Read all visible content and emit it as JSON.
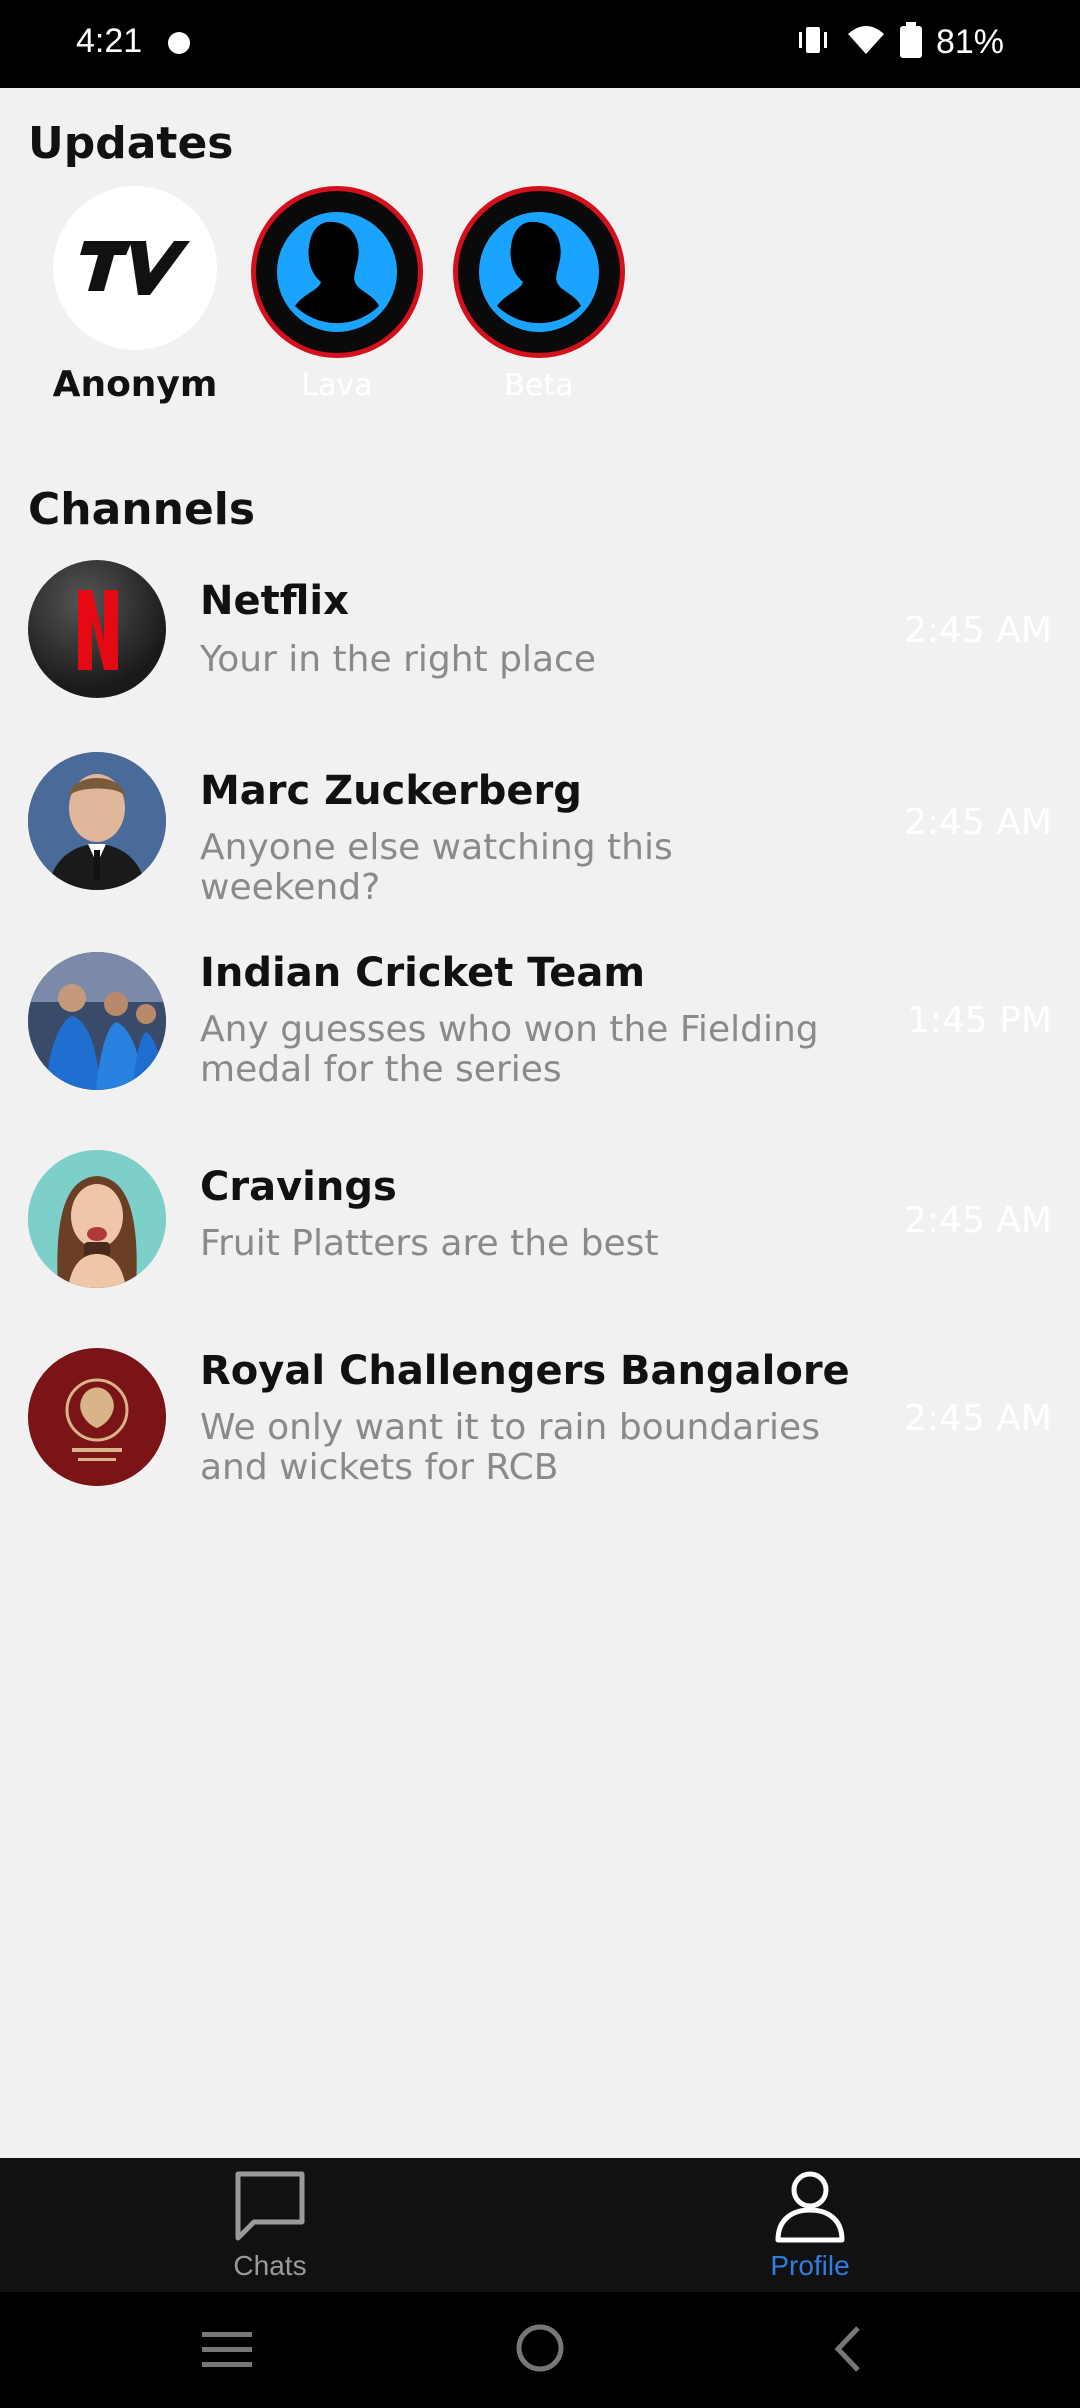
{
  "status_bar": {
    "time": "4:21",
    "battery": "81%"
  },
  "updates": {
    "title": "Updates",
    "stories": [
      {
        "label": "Anonym",
        "icon": "tv-logo-icon"
      },
      {
        "label": "Lava",
        "icon": "person-silhouette-icon"
      },
      {
        "label": "Beta",
        "icon": "person-silhouette-icon"
      }
    ]
  },
  "channels": {
    "title": "Channels",
    "items": [
      {
        "name": "Netflix",
        "message": "Your in the right place",
        "time": "2:45 AM",
        "icon": "netflix-logo"
      },
      {
        "name": "Marc Zuckerberg",
        "message": "Anyone else watching this weekend?",
        "time": "2:45 AM",
        "icon": "person-photo"
      },
      {
        "name": "Indian Cricket Team",
        "message": "Any guesses who won the Fielding medal for the series",
        "time": "1:45 PM",
        "icon": "team-photo"
      },
      {
        "name": "Cravings",
        "message": "Fruit Platters are the best",
        "time": "2:45 AM",
        "icon": "person-photo"
      },
      {
        "name": "Royal Challengers Bangalore",
        "message": "We only want it to rain boundaries and wickets for RCB",
        "time": "2:45 AM",
        "icon": "rcb-logo"
      }
    ]
  },
  "bottom_nav": {
    "tabs": [
      {
        "label": "Chats",
        "icon": "chat-bubble-icon"
      },
      {
        "label": "Profile",
        "icon": "person-icon",
        "active": true
      }
    ]
  },
  "colors": {
    "accent": "#2f7de1",
    "ring": "#d4101c",
    "netflix_red": "#e50914",
    "rcb_red": "#7a1417"
  }
}
